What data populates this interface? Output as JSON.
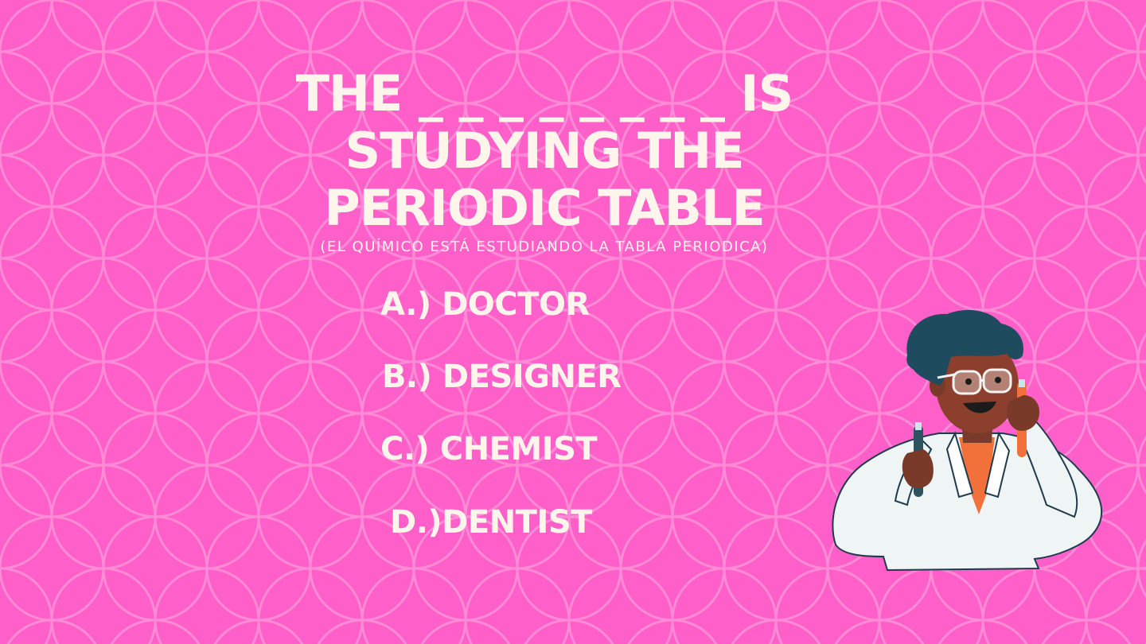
{
  "slide": {
    "background_color": "#ff5fc8",
    "pattern_color": "#ff8ad6",
    "text_color": "#fff5ea"
  },
  "question": {
    "line1": "THE _ _ _ _ _ _ _ _ IS",
    "line2": "STUDYING THE",
    "line3": "PERIODIC TABLE"
  },
  "translation": "(EL QUÍMICO ESTÁ ESTUDIANDO LA TABLA PERIODICA)",
  "options": [
    {
      "label": "A.) DOCTOR"
    },
    {
      "label": "B.) DESIGNER"
    },
    {
      "label": "C.) CHEMIST"
    },
    {
      "label": "D.)DENTIST"
    }
  ],
  "illustration": {
    "icon": "chemist-illustration"
  }
}
